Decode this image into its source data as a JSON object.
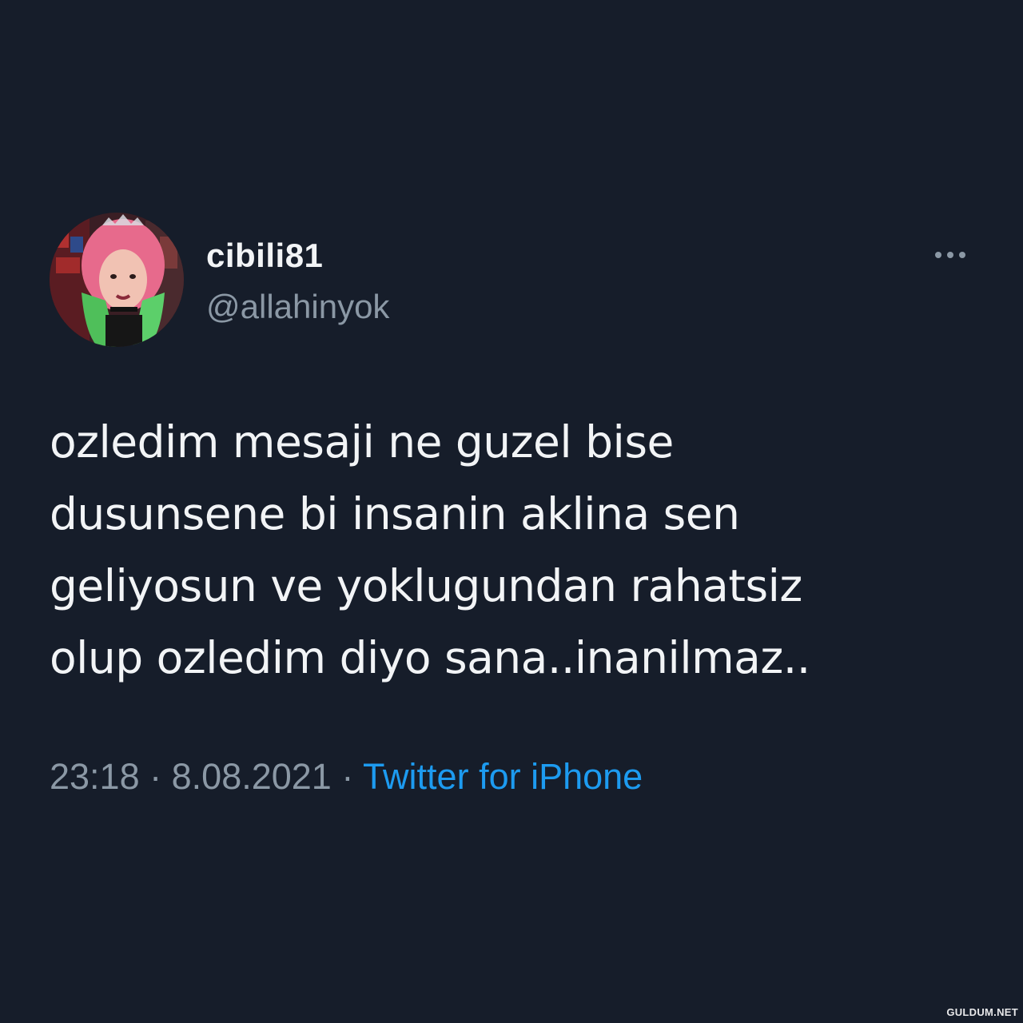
{
  "user": {
    "display_name": "cibili81",
    "handle": "@allahinyok",
    "avatar_icon": "profile-photo-avatar"
  },
  "menu": {
    "more_icon": "more-horizontal-icon"
  },
  "tweet": {
    "lines": [
      "ozledim mesaji ne guzel bise",
      "dusunsene bi insanin aklina sen",
      "geliyosun ve yoklugundan rahatsiz",
      "olup ozledim diyo sana..inanilmaz.."
    ]
  },
  "meta": {
    "time": "23:18",
    "separator": "·",
    "date": "8.08.2021",
    "source": "Twitter for iPhone"
  },
  "watermark": {
    "text": "GULDUM.NET"
  },
  "colors": {
    "background": "#161d2a",
    "text_primary": "#f2f4f6",
    "text_secondary": "#8b98a5",
    "link": "#1d9bf0"
  }
}
